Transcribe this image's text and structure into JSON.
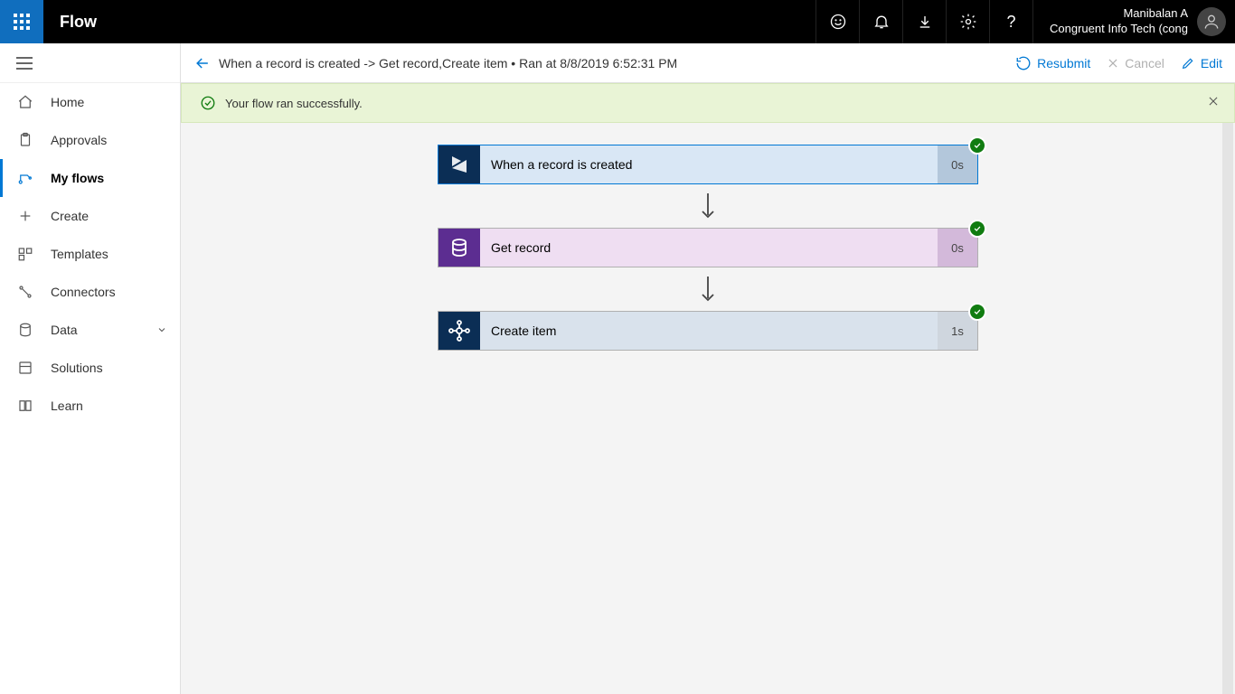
{
  "header": {
    "brand": "Flow",
    "user_name": "Manibalan A",
    "user_org": "Congruent Info Tech (cong"
  },
  "sidebar": {
    "items": [
      {
        "label": "Home"
      },
      {
        "label": "Approvals"
      },
      {
        "label": "My flows"
      },
      {
        "label": "Create"
      },
      {
        "label": "Templates"
      },
      {
        "label": "Connectors"
      },
      {
        "label": "Data"
      },
      {
        "label": "Solutions"
      },
      {
        "label": "Learn"
      }
    ]
  },
  "cmdbar": {
    "title": "When a record is created -> Get record,Create item  •  Ran at 8/8/2019 6:52:31 PM",
    "resubmit": "Resubmit",
    "cancel": "Cancel",
    "edit": "Edit"
  },
  "banner": {
    "message": "Your flow ran successfully."
  },
  "flow": {
    "steps": [
      {
        "title": "When a record is created",
        "time": "0s"
      },
      {
        "title": "Get record",
        "time": "0s"
      },
      {
        "title": "Create item",
        "time": "1s"
      }
    ]
  }
}
